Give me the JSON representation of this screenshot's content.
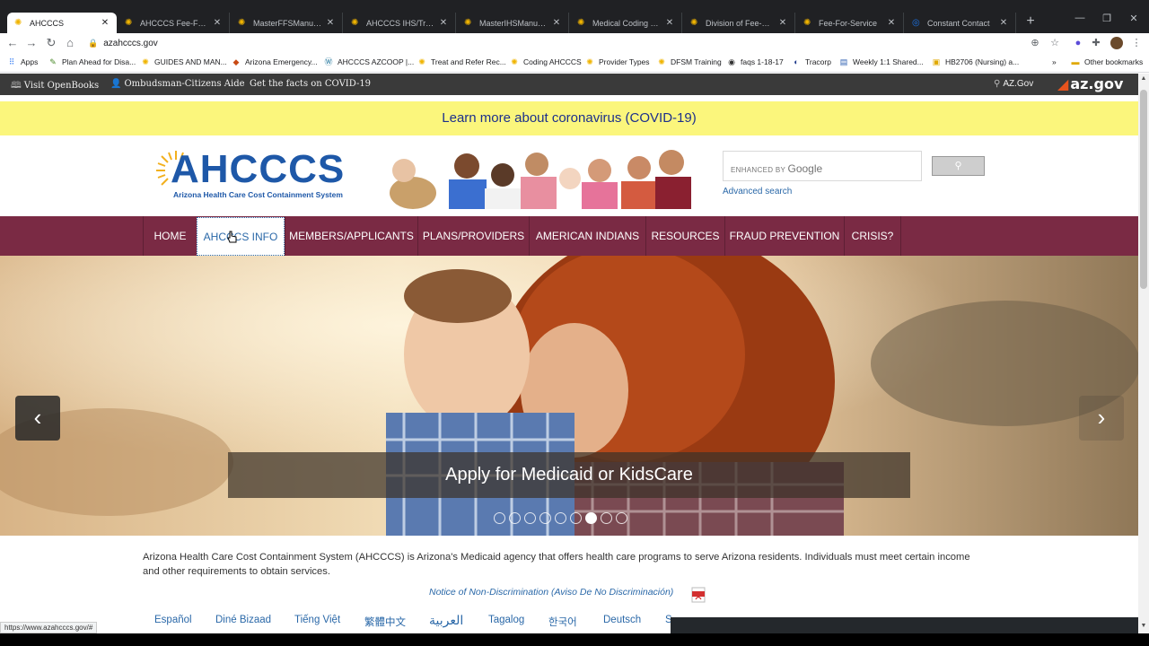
{
  "browser": {
    "tabs": [
      {
        "title": "AHCCCS",
        "active": true
      },
      {
        "title": "AHCCCS Fee-For-Servic"
      },
      {
        "title": "MasterFFSManual.pdf"
      },
      {
        "title": "AHCCCS IHS/Tribal Pro"
      },
      {
        "title": "MasterIHSManual.pdf"
      },
      {
        "title": "Medical Coding Resou"
      },
      {
        "title": "Division of Fee-For-Ser"
      },
      {
        "title": "Fee-For-Service"
      },
      {
        "title": "Constant Contact"
      }
    ],
    "new_tab": "+",
    "url": "azahcccs.gov",
    "bookmarks": [
      "Apps",
      "Plan Ahead for Disa...",
      "GUIDES AND MAN...",
      "Arizona Emergency...",
      "AHCCCS AZCOOP |...",
      "Treat and Refer Rec...",
      "Coding AHCCCS",
      "Provider Types",
      "DFSM Training",
      "faqs 1-18-17",
      "Tracorp",
      "Weekly 1:1 Shared...",
      "HB2706 (Nursing) a..."
    ],
    "more_bookmarks": "»",
    "other_bookmarks": "Other bookmarks",
    "status_url": "https://www.azahcccs.gov/#"
  },
  "topbar": {
    "openbooks": "Visit OpenBooks",
    "ombudsman": "Ombudsman-Citizens Aide",
    "covid_facts": "Get the facts on COVID-19",
    "azgov_link": "AZ.Gov",
    "azgov_logo": "az.gov"
  },
  "banner": {
    "covid": "Learn more about coronavirus (COVID-19)"
  },
  "header": {
    "logo_text": "AHCCCS",
    "logo_sub": "Arizona Health Care Cost Containment System",
    "search_enhanced": "ENHANCED BY",
    "search_google": "Google",
    "search_button_icon": "search-icon",
    "advanced_search": "Advanced search"
  },
  "nav": {
    "items": [
      {
        "label": "HOME"
      },
      {
        "label": "AHCCCS INFO",
        "active": true
      },
      {
        "label": "MEMBERS/APPLICANTS"
      },
      {
        "label": "PLANS/PROVIDERS"
      },
      {
        "label": "AMERICAN INDIANS"
      },
      {
        "label": "RESOURCES"
      },
      {
        "label": "FRAUD PREVENTION"
      },
      {
        "label": "CRISIS?"
      }
    ]
  },
  "hero": {
    "caption": "Apply for Medicaid or KidsCare",
    "prev": "‹",
    "next": "›",
    "slide_count": 9,
    "active_slide": 7
  },
  "content": {
    "intro": "Arizona Health Care Cost Containment System (AHCCCS) is Arizona's Medicaid agency that offers health care programs to serve Arizona residents. Individuals must meet certain income and other requirements to obtain services.",
    "notice": "Notice of Non-Discrimination (Aviso De No Discriminación)",
    "languages": [
      "Español",
      "Diné Bizaad",
      "Tiếng Việt",
      "繁體中文",
      "العربية",
      "Tagalog",
      "한국어",
      "Deutsch",
      "S"
    ]
  },
  "colors": {
    "nav_bg": "#7a2a44",
    "covid_bg": "#fbf67c",
    "covid_text": "#1c2f8c",
    "logo_blue": "#1e58a8",
    "link_blue": "#2a68a8"
  }
}
